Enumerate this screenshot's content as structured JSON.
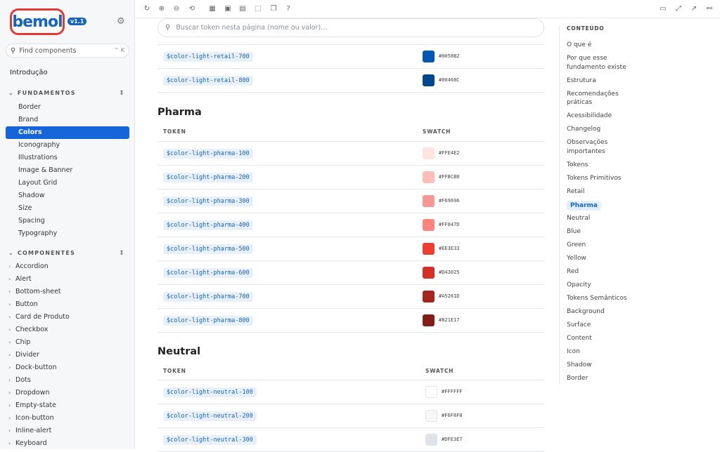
{
  "sidebar": {
    "logo_text": "bemol",
    "version": "v1.1",
    "find_placeholder": "Find components",
    "find_shortcut": "⌃ K",
    "intro": "Introdução",
    "fundamentos_title": "FUNDAMENTOS",
    "fundamentos": [
      "Border",
      "Brand",
      "Colors",
      "Iconography",
      "Illustrations",
      "Image & Banner",
      "Layout Grid",
      "Shadow",
      "Size",
      "Spacing",
      "Typography"
    ],
    "active": "Colors",
    "componentes_title": "COMPONENTES",
    "componentes": [
      "Accordion",
      "Alert",
      "Bottom-sheet",
      "Button",
      "Card de Produto",
      "Checkbox",
      "Chip",
      "Divider",
      "Dock-button",
      "Dots",
      "Dropdown",
      "Empty-state",
      "Icon-button",
      "Inline-alert",
      "Keyboard"
    ]
  },
  "main": {
    "search_placeholder": "Buscar token nesta página (nome ou valor)...",
    "retail_rows": [
      {
        "token": "$color-light-retail-700",
        "hex": "#0058B2",
        "color": "#0058B2"
      },
      {
        "token": "$color-light-retail-800",
        "hex": "#00468C",
        "color": "#00468C"
      }
    ],
    "pharma": {
      "title": "Pharma",
      "col_token": "TOKEN",
      "col_swatch": "SWATCH",
      "rows": [
        {
          "token": "$color-light-pharma-100",
          "hex": "#FFE4E2",
          "color": "#FFE4E2"
        },
        {
          "token": "$color-light-pharma-200",
          "hex": "#FFBCB8",
          "color": "#FFBCB8"
        },
        {
          "token": "$color-light-pharma-300",
          "hex": "#F69696",
          "color": "#F69696"
        },
        {
          "token": "$color-light-pharma-400",
          "hex": "#FF847D",
          "color": "#FF847D"
        },
        {
          "token": "$color-light-pharma-500",
          "hex": "#EE3E33",
          "color": "#EE3E33"
        },
        {
          "token": "$color-light-pharma-600",
          "hex": "#D43025",
          "color": "#D43025"
        },
        {
          "token": "$color-light-pharma-700",
          "hex": "#A5261D",
          "color": "#A5261D"
        },
        {
          "token": "$color-light-pharma-800",
          "hex": "#821E17",
          "color": "#821E17"
        }
      ]
    },
    "neutral": {
      "title": "Neutral",
      "col_token": "TOKEN",
      "col_swatch": "SWATCH",
      "rows": [
        {
          "token": "$color-light-neutral-100",
          "hex": "#FFFFFF",
          "color": "#FFFFFF"
        },
        {
          "token": "$color-light-neutral-200",
          "hex": "#F6F8F8",
          "color": "#F6F8F8"
        },
        {
          "token": "$color-light-neutral-300",
          "hex": "#DFE3E7",
          "color": "#DFE3E7"
        }
      ]
    }
  },
  "toc": {
    "title": "CONTEÚDO",
    "items": [
      "O que é",
      "Por que esse fundamento existe",
      "Estrutura",
      "Recomendações práticas",
      "Acessibilidade",
      "Changelog",
      "Observações importantes",
      "Tokens",
      "Tokens Primitivos",
      "Retail",
      "Pharma",
      "Neutral",
      "Blue",
      "Green",
      "Yellow",
      "Red",
      "Opacity",
      "Tokens Semânticos",
      "Background",
      "Surface",
      "Content",
      "Icon",
      "Shadow",
      "Border"
    ],
    "active": "Pharma"
  },
  "toolbar_icons": [
    "refresh-icon",
    "zoom-in-icon",
    "zoom-out-icon",
    "zoom-reset-icon",
    "grid-icon",
    "image-icon",
    "layout-icon",
    "frame-icon",
    "copy-icon",
    "help-icon",
    "panel-icon",
    "fullscreen-icon",
    "external-link-icon",
    "link-icon"
  ]
}
